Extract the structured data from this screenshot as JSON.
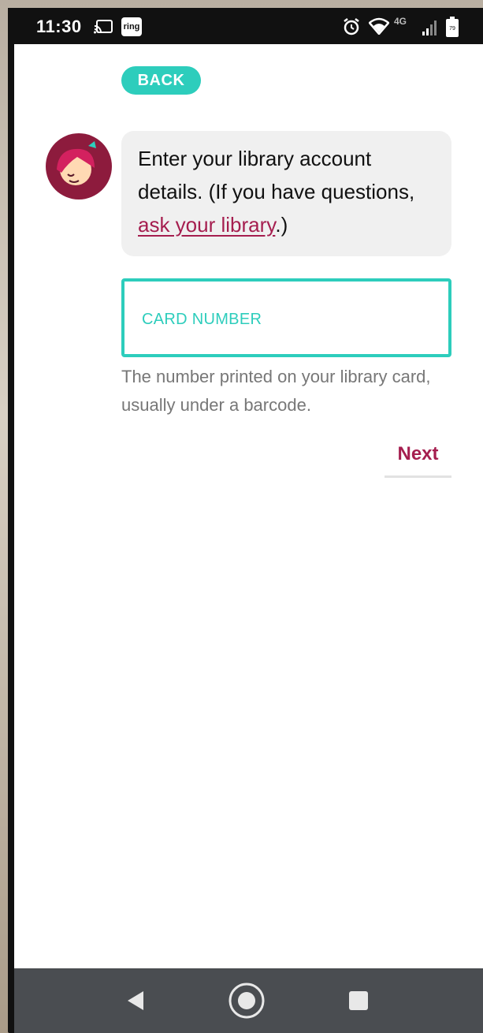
{
  "status_bar": {
    "time": "11:30",
    "ring_badge": "ring",
    "network_label": "4G",
    "battery_level": "79",
    "icons": [
      "cast-icon",
      "ring-app-icon",
      "alarm-icon",
      "wifi-icon",
      "signal-icon",
      "battery-icon"
    ]
  },
  "back_label": "BACK",
  "prompt": {
    "text_before": "Enter your library account details. (If you have questions, ",
    "link_text": "ask your library",
    "text_after": ".)"
  },
  "card_field": {
    "label": "CARD NUMBER",
    "value": "",
    "helper": "The number printed on your library card, usually under a barcode."
  },
  "next_label": "Next",
  "nav_bar": {
    "icons": [
      "back-triangle-icon",
      "home-circle-icon",
      "recents-square-icon"
    ]
  },
  "colors": {
    "accent_teal": "#2dcdbc",
    "accent_berry": "#a51e4f",
    "bubble_bg": "#f0f0f0",
    "nav_bg": "#4a4d51"
  }
}
